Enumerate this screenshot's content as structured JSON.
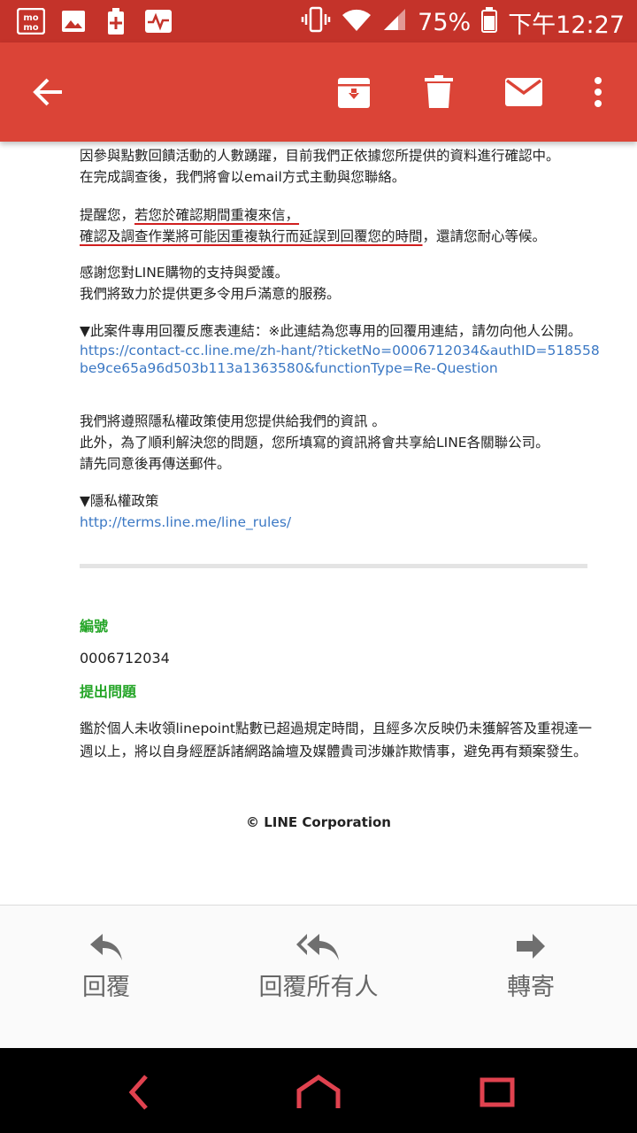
{
  "status_bar": {
    "battery": "75%",
    "time": "下午12:27"
  },
  "email": {
    "p1_line1": "因參與點數回饋活動的人數踴躍，目前我們正依據您所提供的資料進行確認中。",
    "p1_line2": "在完成調查後，我們將會以email方式主動與您聯絡。",
    "p2_line1_a": "提醒您，",
    "p2_line1_b": "若您於確認期間重複來信，",
    "p2_line2_a": "確認及調查作業將可能因重複執行而延誤到回覆您的時間",
    "p2_line2_b": "，還請您耐心等候。",
    "p3_line1": "感謝您對LINE購物的支持與愛護。",
    "p3_line2": "我們將致力於提供更多令用戶滿意的服務。",
    "p4_line1": "▼此案件專用回覆反應表連結：※此連結為您專用的回覆用連結，請勿向他人公開。",
    "p4_link": "https://contact-cc.line.me/zh-hant/?ticketNo=0006712034&authID=518558be9ce65a96d503b113a1363580&functionType=Re-Question",
    "p5_line1": "我們將遵照隱私權政策使用您提供給我們的資訊 。",
    "p5_line2": "此外，為了順利解決您的問題，您所填寫的資訊將會共享給LINE各關聯公司。",
    "p5_line3": "請先同意後再傳送郵件。",
    "p6_line1": "▼隱私權政策",
    "p6_link": "http://terms.line.me/line_rules/",
    "label_number": "編號",
    "ticket_number": "0006712034",
    "label_question": "提出問題",
    "question_text": "鑑於個人未收領linepoint點數已超過規定時間，且經多次反映仍未獲解答及重視達一週以上，將以自身經歷訴諸網路論壇及媒體貴司涉嫌詐欺情事，避免再有類案發生。",
    "copyright": "©  LINE Corporation"
  },
  "actions": {
    "reply": "回覆",
    "reply_all": "回覆所有人",
    "forward": "轉寄"
  },
  "colors": {
    "app_bar": "#db4437",
    "status_bar": "#c4332a",
    "link": "#3b78c4",
    "label_green": "#24a527",
    "nav_red": "#e0424f"
  },
  "icons": [
    "momo-icon",
    "gallery-icon",
    "battery-plus-icon",
    "pulse-icon",
    "vibrate-icon",
    "wifi-icon",
    "signal-icon",
    "battery-icon",
    "back-arrow-icon",
    "archive-icon",
    "delete-icon",
    "mail-icon",
    "more-vert-icon",
    "reply-icon",
    "reply-all-icon",
    "forward-icon",
    "nav-back-icon",
    "nav-home-icon",
    "nav-recents-icon"
  ]
}
